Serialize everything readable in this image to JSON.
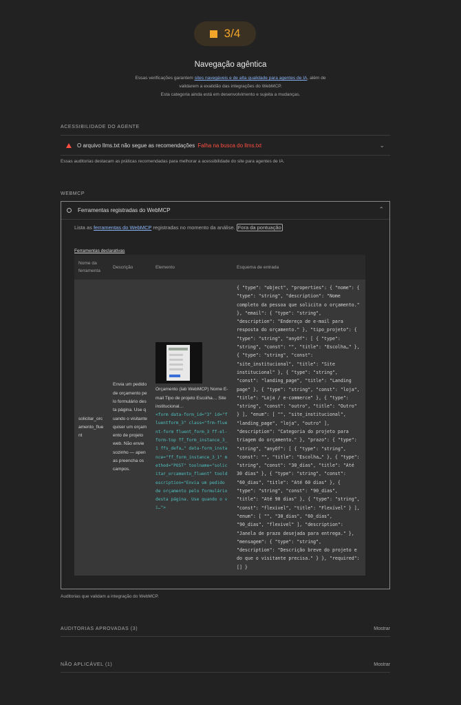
{
  "score": {
    "value": "3/4",
    "color": "#f4a62a"
  },
  "category": {
    "title": "Navegação agêntica",
    "desc_1": "Essas verificações garantem ",
    "desc_link_1": "sites navegáveis e de alta qualidade para agentes de IA",
    "desc_2": ", além de validarem a exatidão das integrações do WebMCP.",
    "desc_3": "Esta categoria ainda está em desenvolvimento e sujeita a mudanças."
  },
  "agent_accessibility": {
    "title": "ACESSIBILIDADE DO AGENTE",
    "audit": {
      "label": "O arquivo llms.txt não segue as recomendações",
      "fail": "Falha na busca do llms.txt",
      "status_color": "#ff4e42"
    },
    "note": "Essas auditorias destacam as práticas recomendadas para melhorar a acessibilidade do site para agentes de IA."
  },
  "webmcp": {
    "title": "WEBMCP",
    "audit": {
      "label": "Ferramentas registradas do WebMCP",
      "desc_1": "Lista as ",
      "desc_link": "ferramentas do WebMCP",
      "desc_2": " registradas no momento da análise.",
      "badge": "Fora da pontuação",
      "subtitle": "Ferramentas declarativas",
      "columns": [
        "Nome da ferramenta",
        "Descrição",
        "Elemento",
        "Esquema de entrada"
      ],
      "rows": [
        {
          "name": "solicitar_orcamento_fluent",
          "description": "Envia um pedido de orçamento pelo formulário desta página. Use quando o visitante quiser um orçamento de projeto web. Não envie sozinho — apenas preencha os campos.",
          "element_text": "Orçamento (lab WebMCP) Nome E-mail Tipo de projeto Escolha… Site institucional…",
          "element_code": "<form data-form_id=\"3\" id=\"fluentform_3\" class=\"frm-fluent-form fluent_form_3 ff-el-form-top ff_form_instance_3_1 ffs_defa…\" data-form_instance=\"ff_form_instance_3_1\" method=\"POST\" toolname=\"solicitar_orcamento_fluent\" tooldescription=\"Envia um pedido de orçamento pelo formulário desta página. Use quando o vi…\">",
          "schema": "{ \"type\": \"object\", \"properties\": { \"nome\": { \"type\": \"string\", \"description\": \"Nome completo da pessoa que solicita o orçamento.\" }, \"email\": { \"type\": \"string\", \"description\": \"Endereço de e-mail para resposta do orçamento.\" }, \"tipo_projeto\": { \"type\": \"string\", \"anyOf\": [ { \"type\": \"string\", \"const\": \"\", \"title\": \"Escolha…\" }, { \"type\": \"string\", \"const\": \"site_institucional\", \"title\": \"Site institucional\" }, { \"type\": \"string\", \"const\": \"landing_page\", \"title\": \"Landing page\" }, { \"type\": \"string\", \"const\": \"loja\", \"title\": \"Loja / e-commerce\" }, { \"type\": \"string\", \"const\": \"outro\", \"title\": \"Outro\" } ], \"enum\": [ \"\", \"site_institucional\", \"landing_page\", \"loja\", \"outro\" ], \"description\": \"Categoria do projeto para triagem do orçamento.\" }, \"prazo\": { \"type\": \"string\", \"anyOf\": [ { \"type\": \"string\", \"const\": \"\", \"title\": \"Escolha…\" }, { \"type\": \"string\", \"const\": \"30_dias\", \"title\": \"Até 30 dias\" }, { \"type\": \"string\", \"const\": \"60_dias\", \"title\": \"Até 60 dias\" }, { \"type\": \"string\", \"const\": \"90_dias\", \"title\": \"Até 90 dias\" }, { \"type\": \"string\", \"const\": \"flexivel\", \"title\": \"Flexível\" } ], \"enum\": [ \"\", \"30_dias\", \"60_dias\", \"90_dias\", \"flexivel\" ], \"description\": \"Janela de prazo desejada para entrega.\" }, \"mensagem\": { \"type\": \"string\", \"description\": \"Descrição breve do projeto e do que o visitante precisa.\" } }, \"required\": [] }"
        }
      ]
    },
    "note": "Auditorias que validam a integração do WebMCP."
  },
  "passed": {
    "title": "AUDITORIAS APROVADAS (3)",
    "toggle": "Mostrar"
  },
  "not_applicable": {
    "title": "NÃO APLICÁVEL (1)",
    "toggle": "Mostrar"
  }
}
